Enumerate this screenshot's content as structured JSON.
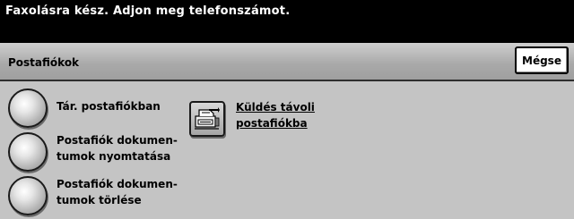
{
  "status": {
    "message": "Faxolásra kész. Adjon meg telefonszámot."
  },
  "header": {
    "title": "Postafiókok",
    "cancel_label": "Mégse"
  },
  "options": [
    {
      "label": "Tár. postafiókban",
      "icon": "radio-button"
    },
    {
      "label": "Postafiók dokumen-\ntumok nyomtatása",
      "icon": "radio-button"
    },
    {
      "label": "Postafiók dokumen-\ntumok törlése",
      "icon": "radio-button"
    }
  ],
  "remote": {
    "label": "Küldés távoli\npostafiókba",
    "icon": "fax-mailbox-icon"
  }
}
